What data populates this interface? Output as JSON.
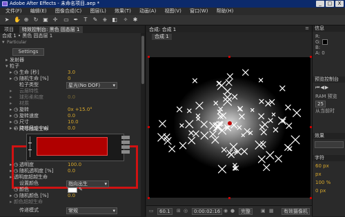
{
  "window": {
    "title": "Adobe After Effects - 未命名项目.aep *",
    "buttons": [
      "_",
      "□",
      "X"
    ]
  },
  "menu": [
    "文件(F)",
    "编辑(E)",
    "图像合成(C)",
    "图层(L)",
    "效果(T)",
    "动画(A)",
    "视图(V)",
    "窗口(W)",
    "帮助(H)"
  ],
  "left_panel": {
    "tabs": [
      "项目",
      "特效控制台: 黑色 固态层 1"
    ],
    "header": "合成 1 • 黑色 固态层 1",
    "effect_name": "Particular",
    "settings_button": "Settings",
    "rows": [
      {
        "label": "发射器",
        "value": "",
        "indent": 1
      },
      {
        "label": "粒子",
        "value": "",
        "indent": 1
      },
      {
        "label": "生命 [秒]",
        "value": "3.0",
        "indent": 2
      },
      {
        "label": "随机生命 [%]",
        "value": "0",
        "indent": 2
      },
      {
        "label": "粒子类型",
        "value": "星光(No DOF)",
        "indent": 2,
        "dropdown": true
      },
      {
        "label": "云层特性",
        "value": "",
        "indent": 2,
        "dim": true
      },
      {
        "label": "球形柔和度",
        "value": "0.0",
        "indent": 2,
        "dim": true
      },
      {
        "label": "材质",
        "value": "",
        "indent": 2,
        "dim": true
      },
      {
        "label": "旋转",
        "value": "0x +15.0°",
        "indent": 2
      },
      {
        "label": "旋转速度",
        "value": "0.0",
        "indent": 2
      },
      {
        "label": "尺寸",
        "value": "10.0",
        "indent": 2
      },
      {
        "label": "随机尺寸 [%]",
        "value": "0.0",
        "indent": 2
      }
    ],
    "size_over_life": "尺寸随超生命",
    "rows2": [
      {
        "label": "透明度",
        "value": "100.0",
        "indent": 2
      },
      {
        "label": "随机透明度 [%]",
        "value": "0.0",
        "indent": 2
      },
      {
        "label": "透明度超越生命",
        "value": "",
        "indent": 2
      },
      {
        "label": "设置颜色",
        "value": "指向出生",
        "indent": 3,
        "dropdown": true
      },
      {
        "label": "颜色",
        "value": "",
        "indent": 3,
        "swatch": true
      },
      {
        "label": "随机颜色 [%]",
        "value": "0.0",
        "indent": 2
      },
      {
        "label": "颜色超越生命",
        "value": "",
        "indent": 2,
        "dim": true
      },
      {
        "label": "传递模式",
        "value": "常规",
        "indent": 2,
        "dropdown": true
      }
    ]
  },
  "comp_panel": {
    "tab_title": "合成: 合成 1",
    "sub_tab": "合成 1",
    "bottom": {
      "zoom": "60.1",
      "timecode": "0:00:02:16",
      "quality": "完整",
      "camera": "有效摄像机"
    }
  },
  "right_panel": {
    "info_head": "信息",
    "info_rows": [
      "R:",
      "G:",
      "B:",
      "A: 0"
    ],
    "preview_head": "预览控制台",
    "ram_label": "RAM 预览",
    "fps": "25",
    "from_current": "从当前时",
    "effects_head": "效果",
    "char_head": "字符",
    "char_rows": [
      "60 px",
      "px",
      "100 %",
      "0 px"
    ]
  },
  "colors": {
    "highlight": "#d11212",
    "graph_fill": "#b00000",
    "value_text": "#d8a82c"
  }
}
